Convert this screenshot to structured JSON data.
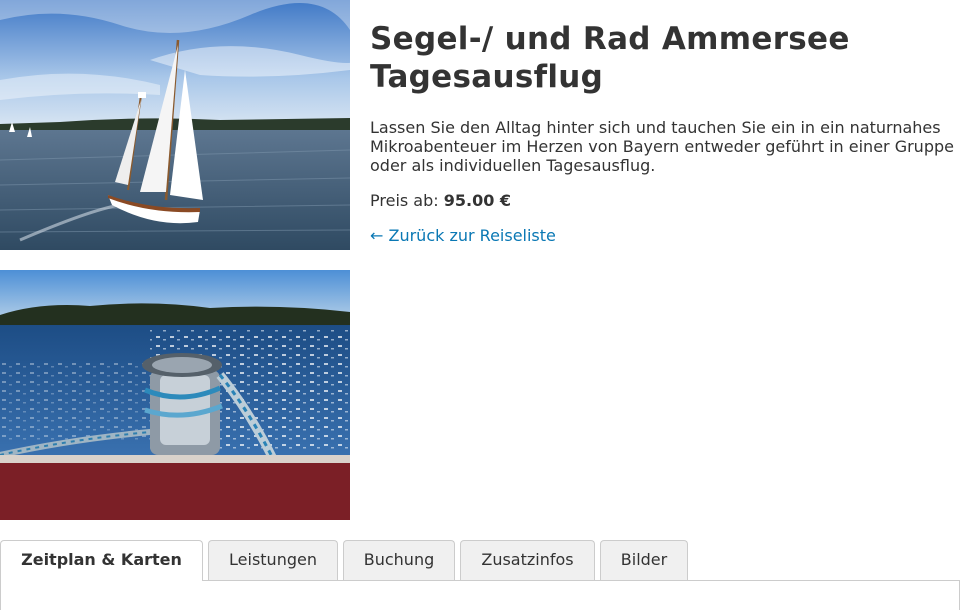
{
  "trip": {
    "title_line1": "Segel-/ und Rad Ammersee",
    "title_line2": "Tagesausflug",
    "description": "Lassen Sie den Alltag hinter sich und tauchen Sie ein in ein naturnahes Mikroabenteuer im Herzen von Bayern entweder geführt in einer Gruppe oder als individuellen Tagesausflug.",
    "price_label": "Preis ab:",
    "price_value": "95.00 €",
    "back_link": "← Zurück zur Reiseliste"
  },
  "tabs": [
    {
      "label": "Zeitplan & Karten",
      "active": true
    },
    {
      "label": "Leistungen",
      "active": false
    },
    {
      "label": "Buchung",
      "active": false
    },
    {
      "label": "Zusatzinfos",
      "active": false
    },
    {
      "label": "Bilder",
      "active": false
    }
  ],
  "colors": {
    "link": "#0a78b4",
    "text": "#333333",
    "tab_border": "#cccccc",
    "tab_inactive_bg": "#f0f0f0"
  }
}
